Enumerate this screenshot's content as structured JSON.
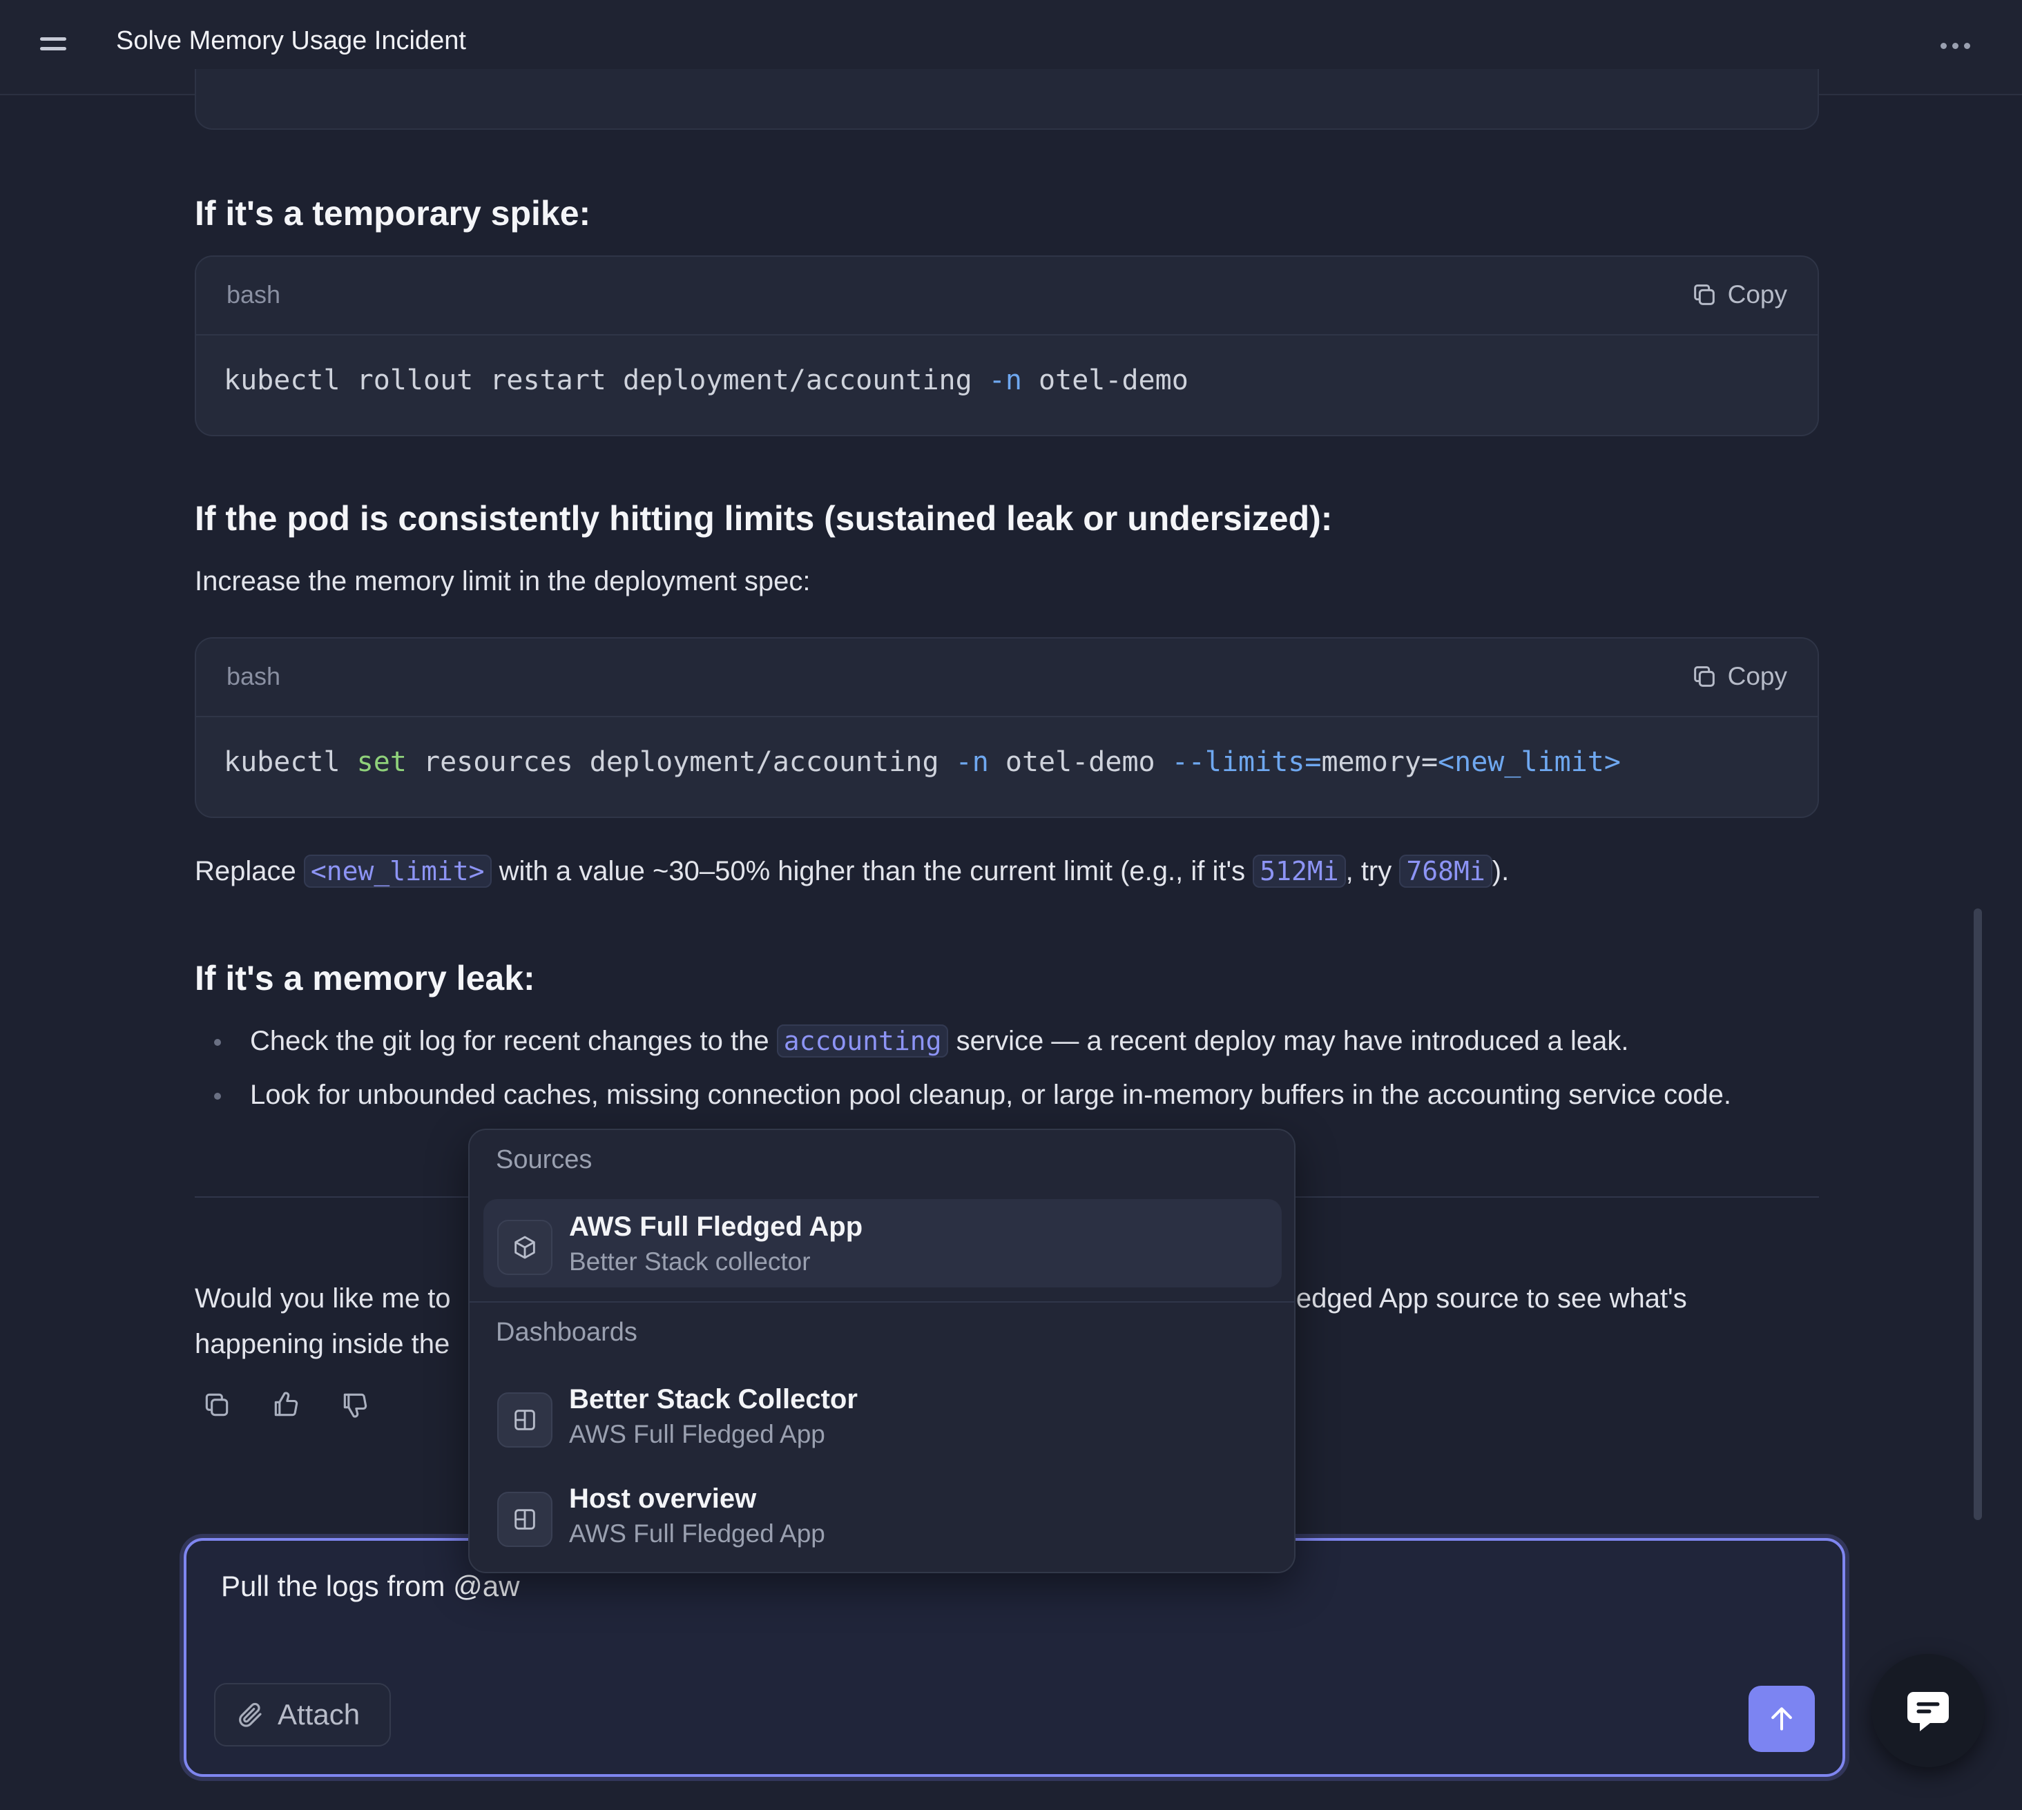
{
  "header": {
    "title": "Solve Memory Usage Incident"
  },
  "section_spike": {
    "heading": "If it's a temporary spike:",
    "code": {
      "lang": "bash",
      "copy_label": "Copy",
      "tokens": [
        "kubectl rollout restart deployment/accounting ",
        "-n",
        " otel-demo"
      ]
    }
  },
  "section_limits": {
    "heading": "If the pod is consistently hitting limits (sustained leak or undersized):",
    "intro": "Increase the memory limit in the deployment spec:",
    "code": {
      "lang": "bash",
      "copy_label": "Copy",
      "tokens": [
        "kubectl ",
        "set",
        " resources deployment/accounting ",
        "-n",
        " otel-demo ",
        "--limits=",
        "memory=",
        "<new_limit>"
      ]
    },
    "replace_note": {
      "t1": "Replace ",
      "c1": "<new_limit>",
      "t2": " with a value ~30–50% higher than the current limit (e.g., if it's ",
      "c2": "512Mi",
      "t3": ", try ",
      "c3": "768Mi",
      "t4": ")."
    }
  },
  "section_leak": {
    "heading": "If it's a memory leak:",
    "bullet1": {
      "t1": "Check the git log for recent changes to the ",
      "code": "accounting",
      "t2": " service — a recent deploy may have introduced a leak."
    },
    "bullet2": "Look for unbounded caches, missing connection pool cleanup, or large in-memory buffers in the accounting service code."
  },
  "followup": {
    "line1_start": "Would you like me to ",
    "line1_end": "ledged App source to see what's",
    "line2_start": "happening inside the "
  },
  "mention_dropdown": {
    "sources_label": "Sources",
    "sources": [
      {
        "title": "AWS Full Fledged App",
        "subtitle": "Better Stack collector",
        "icon": "cube-icon"
      }
    ],
    "dashboards_label": "Dashboards",
    "dashboards": [
      {
        "title": "Better Stack Collector",
        "subtitle": "AWS Full Fledged App",
        "icon": "dashboard-icon"
      },
      {
        "title": "Host overview",
        "subtitle": "AWS Full Fledged App",
        "icon": "dashboard-icon"
      }
    ]
  },
  "composer": {
    "value": "Pull the logs from @aw",
    "attach_label": "Attach"
  },
  "colors": {
    "accent": "#7c84f2",
    "background": "#1d2130",
    "inline_code": "#8d94f5"
  }
}
